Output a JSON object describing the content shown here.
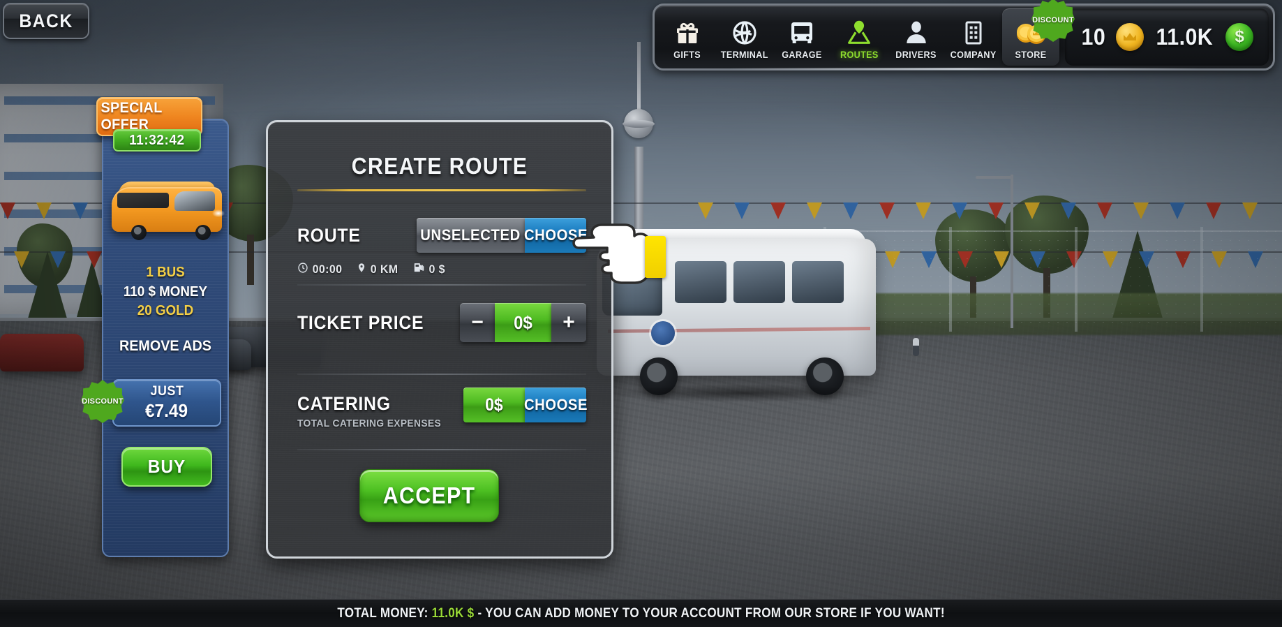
{
  "back_button": {
    "label": "BACK",
    "icon": "back-arrow-icon"
  },
  "topnav": {
    "items": [
      {
        "label": "GIFTS",
        "icon": "gift-icon",
        "active": false
      },
      {
        "label": "TERMINAL",
        "icon": "globe-icon",
        "active": false
      },
      {
        "label": "GARAGE",
        "icon": "bus-icon",
        "active": false
      },
      {
        "label": "ROUTES",
        "icon": "map-pin-icon",
        "active": true
      },
      {
        "label": "DRIVERS",
        "icon": "person-icon",
        "active": false
      },
      {
        "label": "COMPANY",
        "icon": "building-icon",
        "active": false
      },
      {
        "label": "STORE",
        "icon": "coins-icon",
        "active": false
      }
    ],
    "store_badge": "DISCOUNT",
    "active_color": "#8ede2e"
  },
  "wallet": {
    "gold_amount": "10",
    "gold_icon": "gold-coin-icon",
    "money_amount": "11.0K",
    "money_icon": "green-dollar-icon"
  },
  "special_offer": {
    "header": "SPECIAL OFFER",
    "timer": "11:32:42",
    "bus_image": "orange-bus-image",
    "contents": [
      {
        "text": "1 BUS",
        "color": "gold"
      },
      {
        "text": "110 $ MONEY",
        "color": "white"
      },
      {
        "text": "20 GOLD",
        "color": "gold"
      }
    ],
    "remove_ads": "REMOVE ADS",
    "discount_badge": "DISCOUNT",
    "price_label": "JUST",
    "price_value": "€7.49",
    "buy_label": "BUY"
  },
  "dialog": {
    "title": "CREATE ROUTE",
    "accent_color": "#e3b63c",
    "route": {
      "label": "ROUTE",
      "value_button": "UNSELECTED",
      "choose_button": "CHOOSE",
      "stats": [
        {
          "icon": "clock-icon",
          "value": "00:00"
        },
        {
          "icon": "map-pin-icon",
          "value": "0 KM"
        },
        {
          "icon": "fuel-pump-icon",
          "value": "0 $"
        }
      ]
    },
    "ticket_price": {
      "label": "TICKET PRICE",
      "decrease": "−",
      "value": "0$",
      "increase": "+"
    },
    "catering": {
      "label": "CATERING",
      "sublabel": "TOTAL CATERING EXPENSES",
      "value": "0$",
      "choose_button": "CHOOSE"
    },
    "accept_button": "ACCEPT"
  },
  "cursor": {
    "icon": "pointing-hand-cursor"
  },
  "statusbar": {
    "prefix": "TOTAL MONEY: ",
    "money": "11.0K $",
    "suffix": " - YOU CAN ADD MONEY TO YOUR ACCOUNT FROM OUR STORE IF YOU WANT!"
  }
}
